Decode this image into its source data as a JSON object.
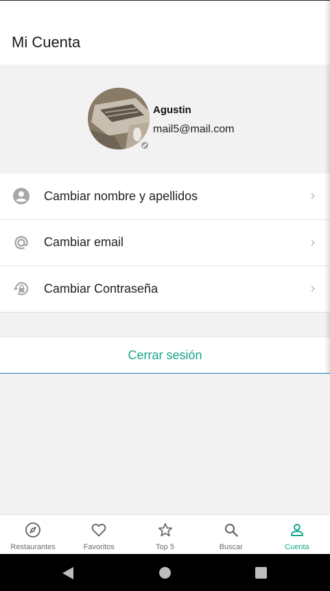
{
  "header": {
    "title": "Mi Cuenta"
  },
  "profile": {
    "name": "Agustin",
    "email": "mail5@mail.com"
  },
  "menu": {
    "items": [
      {
        "label": "Cambiar nombre y apellidos",
        "icon": "account-circle-icon"
      },
      {
        "label": "Cambiar email",
        "icon": "at-sign-icon"
      },
      {
        "label": "Cambiar Contraseña",
        "icon": "lock-reset-icon"
      }
    ]
  },
  "logout": {
    "label": "Cerrar sesión"
  },
  "tabs": [
    {
      "label": "Restaurantes",
      "icon": "compass-icon",
      "active": false
    },
    {
      "label": "Favoritos",
      "icon": "heart-icon",
      "active": false
    },
    {
      "label": "Top 5",
      "icon": "star-icon",
      "active": false
    },
    {
      "label": "Buscar",
      "icon": "search-icon",
      "active": false
    },
    {
      "label": "Cuenta",
      "icon": "person-icon",
      "active": true
    }
  ],
  "colors": {
    "accent": "#17a589",
    "underline": "#1f7fb8",
    "background": "#f2f2f2"
  }
}
